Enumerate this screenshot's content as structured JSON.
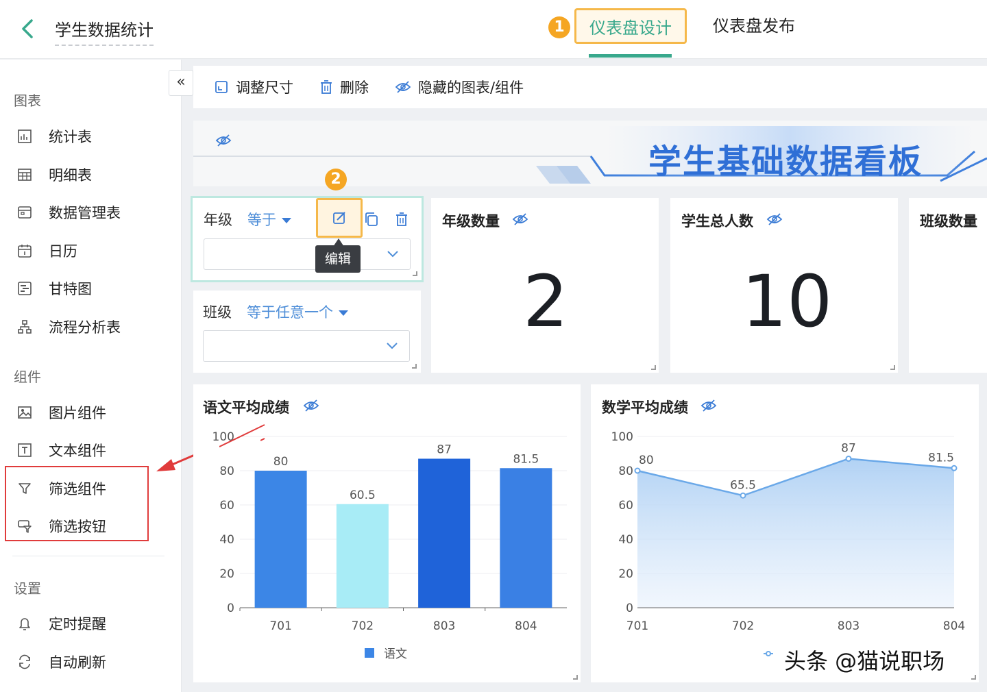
{
  "header": {
    "title": "学生数据统计",
    "tabs": [
      "仪表盘设计",
      "仪表盘发布"
    ],
    "badge1": "1",
    "badge2": "2"
  },
  "sidebar": {
    "sections": [
      {
        "label": "图表",
        "items": [
          {
            "label": "统计表",
            "icon": "stat-table-icon"
          },
          {
            "label": "明细表",
            "icon": "detail-table-icon"
          },
          {
            "label": "数据管理表",
            "icon": "data-manage-icon"
          },
          {
            "label": "日历",
            "icon": "calendar-icon"
          },
          {
            "label": "甘特图",
            "icon": "gantt-icon"
          },
          {
            "label": "流程分析表",
            "icon": "flow-icon"
          }
        ]
      },
      {
        "label": "组件",
        "items": [
          {
            "label": "图片组件",
            "icon": "image-icon"
          },
          {
            "label": "文本组件",
            "icon": "text-icon"
          },
          {
            "label": "筛选组件",
            "icon": "filter-icon"
          },
          {
            "label": "筛选按钮",
            "icon": "filter-button-icon"
          }
        ]
      },
      {
        "label": "设置",
        "items": [
          {
            "label": "定时提醒",
            "icon": "bell-icon"
          },
          {
            "label": "自动刷新",
            "icon": "refresh-icon"
          }
        ]
      }
    ]
  },
  "toolbar": {
    "collapse": "«",
    "resize": "调整尺寸",
    "delete": "删除",
    "hidden": "隐藏的图表/组件"
  },
  "banner": {
    "title": "学生基础数据看板"
  },
  "filters": {
    "grade": {
      "label": "年级",
      "op": "等于"
    },
    "class": {
      "label": "班级",
      "op": "等于任意一个"
    },
    "tooltip": "编辑"
  },
  "kpis": [
    {
      "title": "年级数量",
      "value": "2"
    },
    {
      "title": "学生总人数",
      "value": "10"
    },
    {
      "title": "班级数量",
      "value": ""
    }
  ],
  "chart_data": [
    {
      "type": "bar",
      "title": "语文平均成绩",
      "categories": [
        "701",
        "702",
        "803",
        "804"
      ],
      "series": [
        {
          "name": "语文",
          "values": [
            80,
            60.5,
            87,
            81.5
          ]
        }
      ],
      "yticks": [
        "0",
        "20",
        "40",
        "60",
        "80",
        "100"
      ],
      "ylim": [
        0,
        100
      ],
      "colors": [
        "#3c86e6",
        "#a8ecf6",
        "#1f63d9",
        "#3a80e4"
      ],
      "legend": "bottom-center",
      "grid": true
    },
    {
      "type": "area",
      "title": "数学平均成绩",
      "categories": [
        "701",
        "702",
        "803",
        "804"
      ],
      "series": [
        {
          "values": [
            80,
            65.5,
            87,
            81.5
          ]
        }
      ],
      "yticks": [
        "0",
        "20",
        "40",
        "60",
        "80",
        "100"
      ],
      "ylim": [
        0,
        100
      ],
      "color": "#6aa8e8",
      "grid": true
    }
  ],
  "watermark": "头条 @猫说职场"
}
